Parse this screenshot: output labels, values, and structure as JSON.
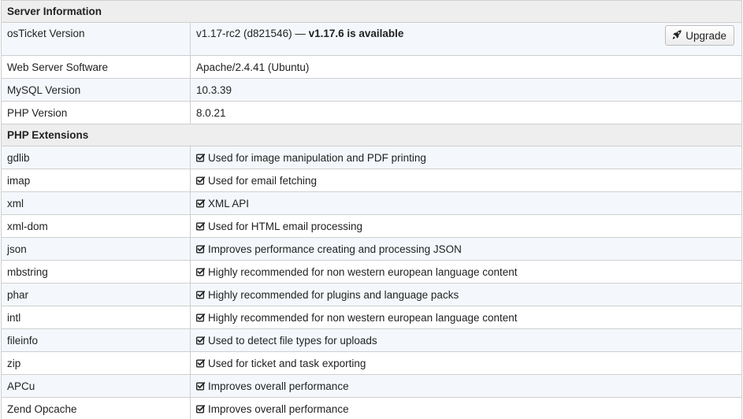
{
  "server_info": {
    "heading": "Server Information",
    "rows": [
      {
        "label": "osTicket Version",
        "value": "v1.17-rc2 (d821546) — ",
        "value_bold": "v1.17.6 is available",
        "button_label": "Upgrade",
        "button_icon": "rocket-icon"
      },
      {
        "label": "Web Server Software",
        "value": "Apache/2.4.41 (Ubuntu)"
      },
      {
        "label": "MySQL Version",
        "value": "10.3.39"
      },
      {
        "label": "PHP Version",
        "value": "8.0.21"
      }
    ]
  },
  "php_extensions": {
    "heading": "PHP Extensions",
    "check_icon": "check-square-icon",
    "rows": [
      {
        "label": "gdlib",
        "value": "Used for image manipulation and PDF printing"
      },
      {
        "label": "imap",
        "value": "Used for email fetching"
      },
      {
        "label": "xml",
        "value": "XML API"
      },
      {
        "label": "xml-dom",
        "value": "Used for HTML email processing"
      },
      {
        "label": "json",
        "value": "Improves performance creating and processing JSON"
      },
      {
        "label": "mbstring",
        "value": "Highly recommended for non western european language content"
      },
      {
        "label": "phar",
        "value": "Highly recommended for plugins and language packs"
      },
      {
        "label": "intl",
        "value": "Highly recommended for non western european language content"
      },
      {
        "label": "fileinfo",
        "value": "Used to detect file types for uploads"
      },
      {
        "label": "zip",
        "value": "Used for ticket and task exporting"
      },
      {
        "label": "APCu",
        "value": "Improves overall performance"
      },
      {
        "label": "Zend Opcache",
        "value": "Improves overall performance"
      }
    ]
  }
}
